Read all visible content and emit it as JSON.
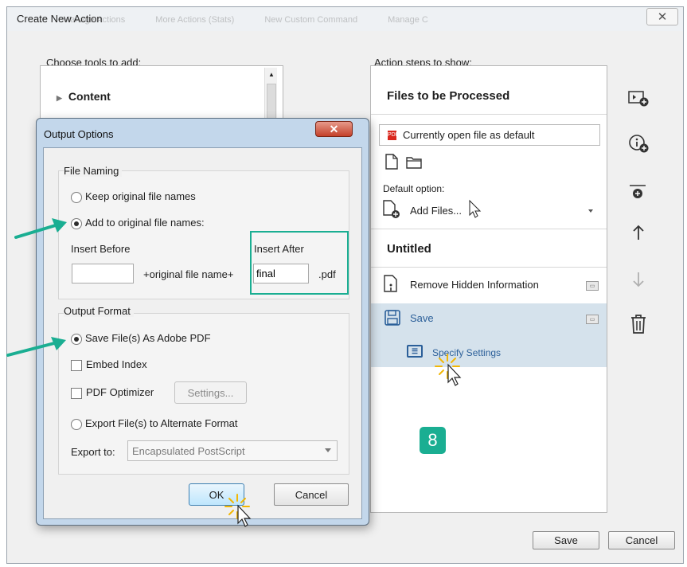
{
  "window": {
    "title": "Create New Action",
    "ghost_toolbar": [
      "Manage Actions",
      "More Actions (Stats)",
      "New Custom Command",
      "Manage C"
    ],
    "close_glyph": "✕"
  },
  "left_panel": {
    "heading": "Choose tools to add:",
    "items": [
      "Content"
    ]
  },
  "right_panel": {
    "heading": "Action steps to show:",
    "files_section": "Files to be Processed",
    "file_combo": "Currently open file as default",
    "default_option_label": "Default option:",
    "add_files": "Add Files...",
    "untitled": "Untitled",
    "steps": [
      {
        "label": "Remove Hidden Information"
      },
      {
        "label": "Save"
      }
    ],
    "specify_settings": "Specify Settings"
  },
  "side_icons": [
    "add-file-icon",
    "add-info-icon",
    "add-divider-icon",
    "move-up-icon",
    "move-down-icon",
    "delete-icon"
  ],
  "step_badge": "8",
  "footer": {
    "save": "Save",
    "cancel": "Cancel"
  },
  "output_dialog": {
    "title": "Output Options",
    "file_naming": "File Naming",
    "keep_original": "Keep original file names",
    "add_to_original": "Add to original file names:",
    "insert_before": "Insert Before",
    "insert_after": "Insert After",
    "insert_before_value": "",
    "insert_after_value": "final",
    "mid_text": "+original file name+",
    "ext": ".pdf",
    "output_format": "Output Format",
    "save_as_pdf": "Save File(s) As Adobe PDF",
    "embed_index": "Embed Index",
    "pdf_optimizer": "PDF Optimizer",
    "settings": "Settings...",
    "export_alt": "Export File(s) to Alternate Format",
    "export_to": "Export to:",
    "export_format": "Encapsulated PostScript",
    "ok": "OK",
    "cancel": "Cancel"
  },
  "colors": {
    "accent": "#1aae92",
    "link": "#2b5f99",
    "selection": "#d5e2ec"
  }
}
